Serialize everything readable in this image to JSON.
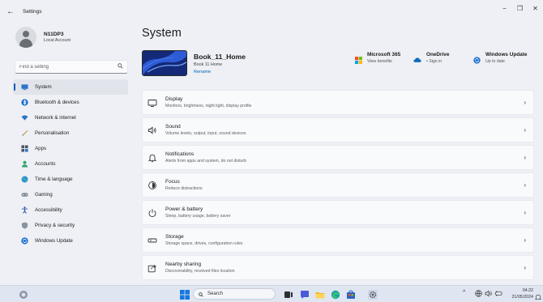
{
  "window": {
    "title": "Settings",
    "back_glyph": "←",
    "minimize_glyph": "−",
    "restore_glyph": "❐",
    "close_glyph": "✕"
  },
  "profile": {
    "name": "N11DP3",
    "account": "Local Account"
  },
  "search": {
    "placeholder": "Find a setting",
    "icon": "search-icon"
  },
  "nav": [
    {
      "label": "System",
      "icon": "monitor-icon",
      "active": true
    },
    {
      "label": "Bluetooth & devices",
      "icon": "bluetooth-icon"
    },
    {
      "label": "Network & internet",
      "icon": "wifi-icon"
    },
    {
      "label": "Personalisation",
      "icon": "brush-icon"
    },
    {
      "label": "Apps",
      "icon": "apps-icon"
    },
    {
      "label": "Accounts",
      "icon": "person-icon"
    },
    {
      "label": "Time & language",
      "icon": "globe-clock-icon"
    },
    {
      "label": "Gaming",
      "icon": "gamepad-icon"
    },
    {
      "label": "Accessibility",
      "icon": "accessibility-icon"
    },
    {
      "label": "Privacy & security",
      "icon": "shield-icon"
    },
    {
      "label": "Windows Update",
      "icon": "update-icon"
    }
  ],
  "main": {
    "title": "System",
    "device": {
      "name": "Book_11_Home",
      "model": "Book 11 Home",
      "rename": "Rename"
    },
    "quick": [
      {
        "title": "Microsoft 365",
        "sub": "View benefits",
        "icon": "microsoft-logo-icon"
      },
      {
        "title": "OneDrive",
        "sub": "• Sign in",
        "icon": "onedrive-cloud-icon"
      },
      {
        "title": "Windows Update",
        "sub": "Up to date",
        "icon": "update-icon"
      }
    ],
    "cards": [
      {
        "title": "Display",
        "desc": "Monitors, brightness, night light, display profile",
        "icon": "display-icon"
      },
      {
        "title": "Sound",
        "desc": "Volume levels, output, input, sound devices",
        "icon": "speaker-icon"
      },
      {
        "title": "Notifications",
        "desc": "Alerts from apps and system, do not disturb",
        "icon": "bell-icon"
      },
      {
        "title": "Focus",
        "desc": "Reduce distractions",
        "icon": "focus-icon"
      },
      {
        "title": "Power & battery",
        "desc": "Sleep, battery usage, battery saver",
        "icon": "power-icon"
      },
      {
        "title": "Storage",
        "desc": "Storage space, drives, configuration rules",
        "icon": "storage-icon"
      },
      {
        "title": "Nearby sharing",
        "desc": "Discoverability, received files location",
        "icon": "share-icon"
      }
    ],
    "chevron": "›"
  },
  "taskbar": {
    "search_label": "Search",
    "time": "04:22",
    "date": "21/05/2024",
    "tray_chevron": "^"
  },
  "colors": {
    "accent": "#005fb8",
    "background": "#eef0f5",
    "card": "#f9fafc"
  }
}
